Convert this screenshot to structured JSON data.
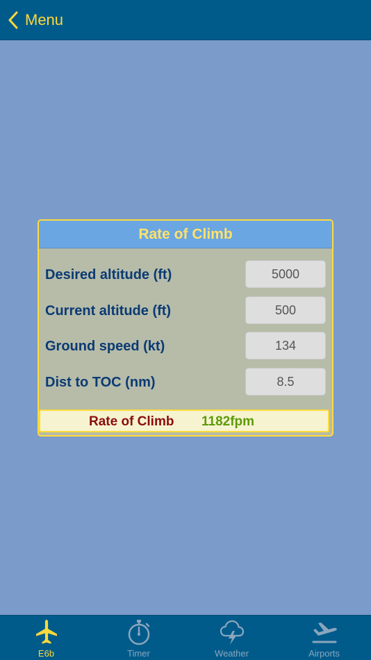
{
  "colors": {
    "accent": "#ffd83a",
    "navbar": "#005b8b",
    "background": "#7b9bca",
    "card_header": "#6aa6e2",
    "card_body": "#b6bca8",
    "label_text": "#0b3a74",
    "result_label": "#8b0d0d",
    "result_value": "#5d9a07",
    "tab_inactive": "#8ba6bd"
  },
  "navbar": {
    "back_icon": "chevron-left-icon",
    "back_label": "Menu"
  },
  "card": {
    "title": "Rate of Climb",
    "fields": [
      {
        "label": "Desired altitude (ft)",
        "value": "5000"
      },
      {
        "label": "Current altitude (ft)",
        "value": "500"
      },
      {
        "label": "Ground speed (kt)",
        "value": "134"
      },
      {
        "label": "Dist to TOC (nm)",
        "value": "8.5"
      }
    ],
    "result": {
      "label": "Rate of Climb",
      "value": "1182fpm"
    }
  },
  "tabbar": {
    "active_index": 0,
    "tabs": [
      {
        "label": "E6b",
        "icon": "airplane-icon"
      },
      {
        "label": "Timer",
        "icon": "stopwatch-icon"
      },
      {
        "label": "Weather",
        "icon": "storm-cloud-icon"
      },
      {
        "label": "Airports",
        "icon": "airplane-departure-icon"
      }
    ]
  }
}
